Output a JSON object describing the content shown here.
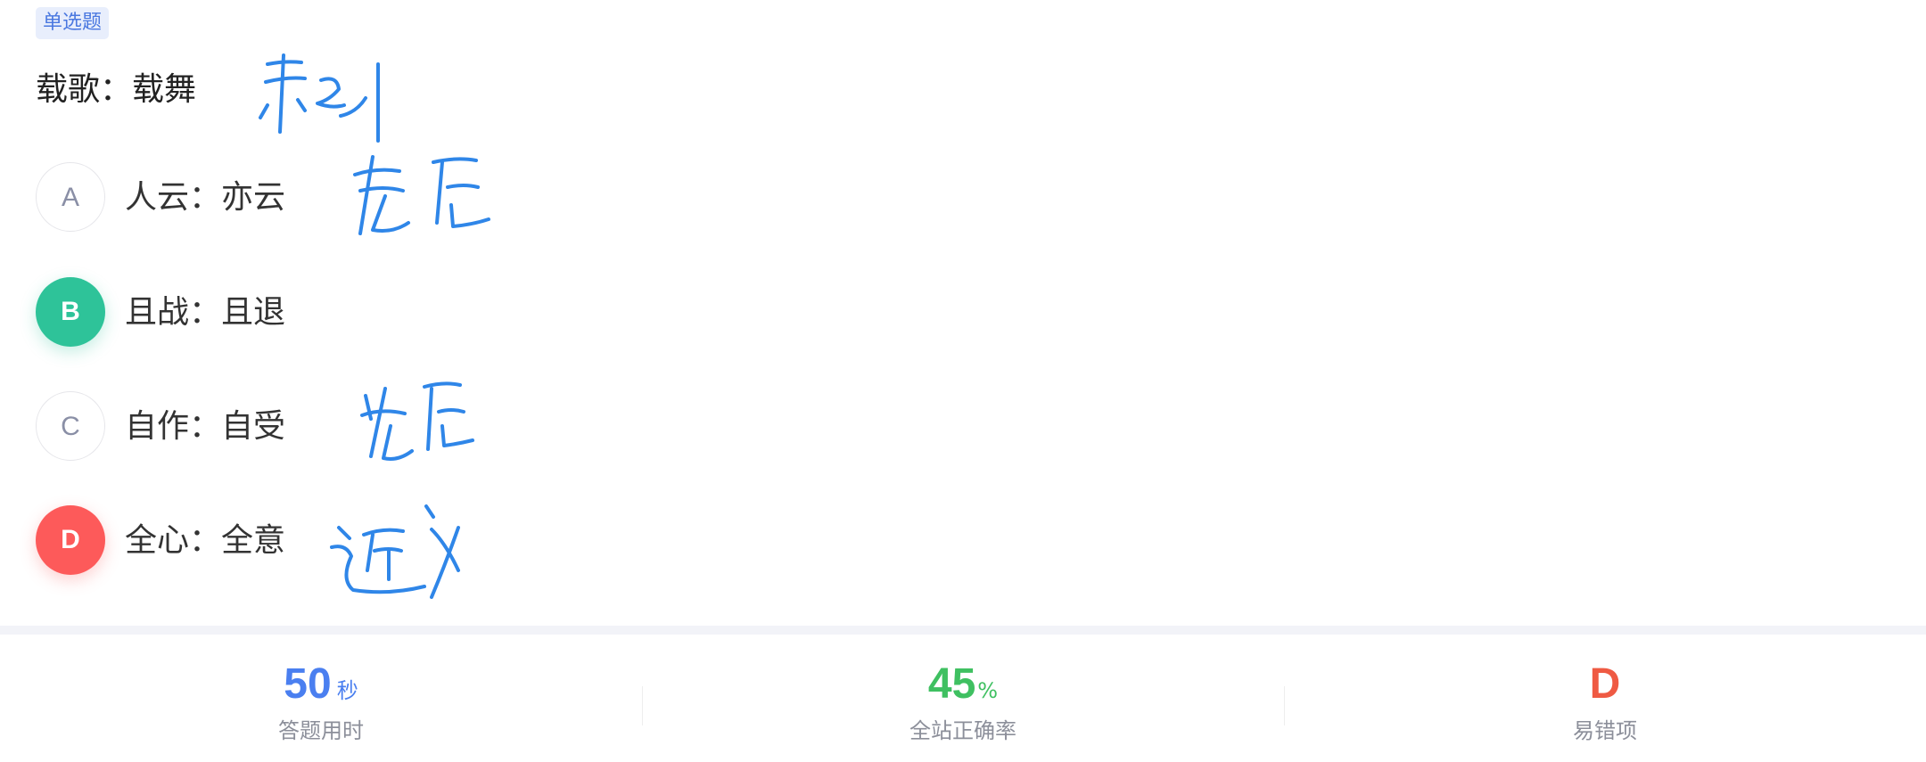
{
  "question": {
    "type_tag": "单选题",
    "stem": "载歌：载舞",
    "options": [
      {
        "letter": "A",
        "text": "人云：亦云",
        "state": "plain"
      },
      {
        "letter": "B",
        "text": "且战：且退",
        "state": "correct"
      },
      {
        "letter": "C",
        "text": "自作：自受",
        "state": "plain"
      },
      {
        "letter": "D",
        "text": "全心：全意",
        "state": "wrong"
      }
    ]
  },
  "handwriting": {
    "stem_note": "并列",
    "option_a_note": "先后",
    "option_c_note": "先后",
    "option_d_note": "近义",
    "ink_color": "#2f86e8"
  },
  "stats": {
    "time": {
      "value": "50",
      "unit": "秒",
      "label": "答题用时",
      "color": "#4a7ff0"
    },
    "accuracy": {
      "value": "45",
      "unit": "%",
      "label": "全站正确率",
      "color": "#3fc061"
    },
    "common_wrong": {
      "value": "D",
      "unit": "",
      "label": "易错项",
      "color": "#ef5a43"
    }
  },
  "colors": {
    "correct": "#2ec399",
    "wrong": "#fd5a5a",
    "tag_bg": "#e8eefc",
    "tag_text": "#4a78e0",
    "separator": "#f2f3f8"
  }
}
